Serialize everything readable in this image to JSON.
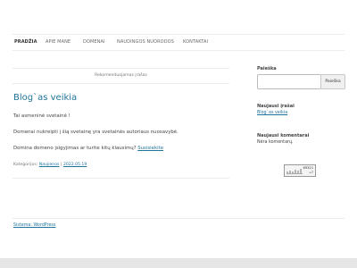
{
  "nav": {
    "items": [
      {
        "label": "Pradžia",
        "active": true
      },
      {
        "label": "Apie mane"
      },
      {
        "label": "Domenai"
      },
      {
        "label": "Naudingos nuorodos"
      },
      {
        "label": "Kontaktai"
      }
    ]
  },
  "main": {
    "sticky_label": "Rekomenduojamas įrašas",
    "post": {
      "title": "Blog`as veikia",
      "paragraphs": [
        "Tai asmeninė svetainė !",
        "Domenai nukreipti į šią svetainę yra svetainės autoriaus nuosavybė.",
        "Domina domeno įsigyjimas ar turite kitų klausimų?"
      ],
      "link_text": "Susisiekite",
      "meta_prefix": "Kategorijos:",
      "category": "Naujienos",
      "separator": "|",
      "date": "2022.05.19"
    }
  },
  "sidebar": {
    "search": {
      "title": "Paieška",
      "value": "",
      "button_label": "Paieška"
    },
    "recent_posts": {
      "title": "Naujausi įrašai",
      "items": [
        "Blog`as veikia"
      ]
    },
    "recent_comments": {
      "title": "Naujausi komentarai",
      "empty_text": "Nėra komentarų."
    },
    "counter": {
      "value": "69321",
      "delta": "+7"
    }
  },
  "footer": {
    "credit": "Sistema: WordPress"
  },
  "colors": {
    "link": "#21759b",
    "background": "#e6e6e6",
    "content": "#ffffff"
  }
}
